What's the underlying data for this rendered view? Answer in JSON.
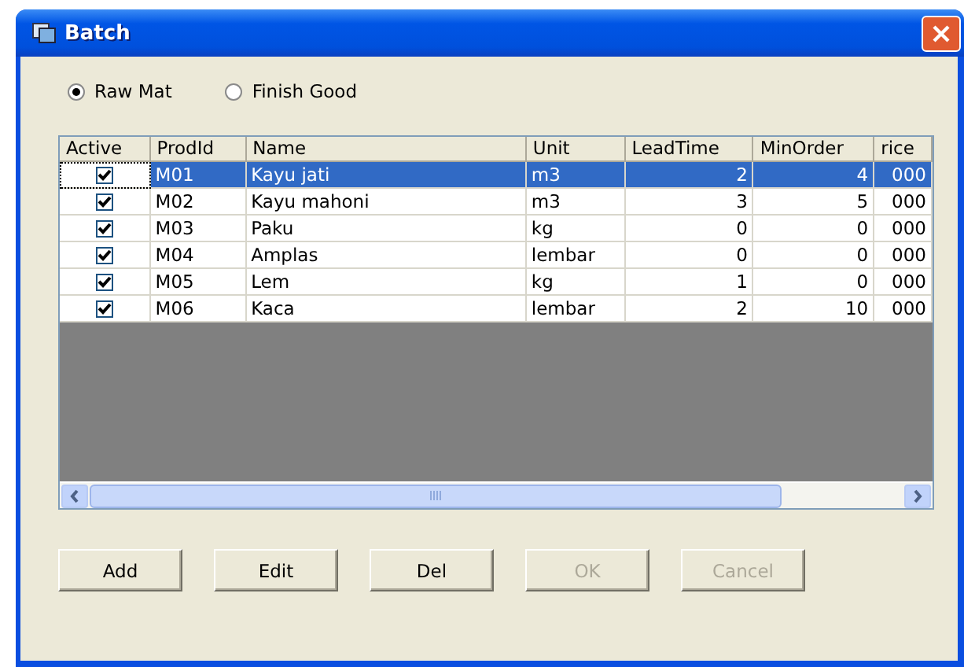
{
  "window": {
    "title": "Batch"
  },
  "radios": [
    {
      "label": "Raw Mat",
      "selected": true
    },
    {
      "label": "Finish Good",
      "selected": false
    }
  ],
  "table": {
    "columns": [
      "Active",
      "ProdId",
      "Name",
      "Unit",
      "LeadTime",
      "MinOrder",
      "rice"
    ],
    "rows": [
      {
        "active": true,
        "selected": true,
        "cells": [
          "",
          "M01",
          "Kayu jati",
          "m3",
          "2",
          "4",
          "000"
        ]
      },
      {
        "active": true,
        "selected": false,
        "cells": [
          "",
          "M02",
          "Kayu mahoni",
          "m3",
          "3",
          "5",
          "000"
        ]
      },
      {
        "active": true,
        "selected": false,
        "cells": [
          "",
          "M03",
          "Paku",
          "kg",
          "0",
          "0",
          "000"
        ]
      },
      {
        "active": true,
        "selected": false,
        "cells": [
          "",
          "M04",
          "Amplas",
          "lembar",
          "0",
          "0",
          "000"
        ]
      },
      {
        "active": true,
        "selected": false,
        "cells": [
          "",
          "M05",
          "Lem",
          "kg",
          "1",
          "0",
          "000"
        ]
      },
      {
        "active": true,
        "selected": false,
        "cells": [
          "",
          "M06",
          "Kaca",
          "lembar",
          "2",
          "10",
          "000"
        ]
      }
    ]
  },
  "buttons": [
    {
      "label": "Add",
      "disabled": false
    },
    {
      "label": "Edit",
      "disabled": false
    },
    {
      "label": "Del",
      "disabled": false
    },
    {
      "label": "OK",
      "disabled": true
    },
    {
      "label": "Cancel",
      "disabled": true
    }
  ]
}
